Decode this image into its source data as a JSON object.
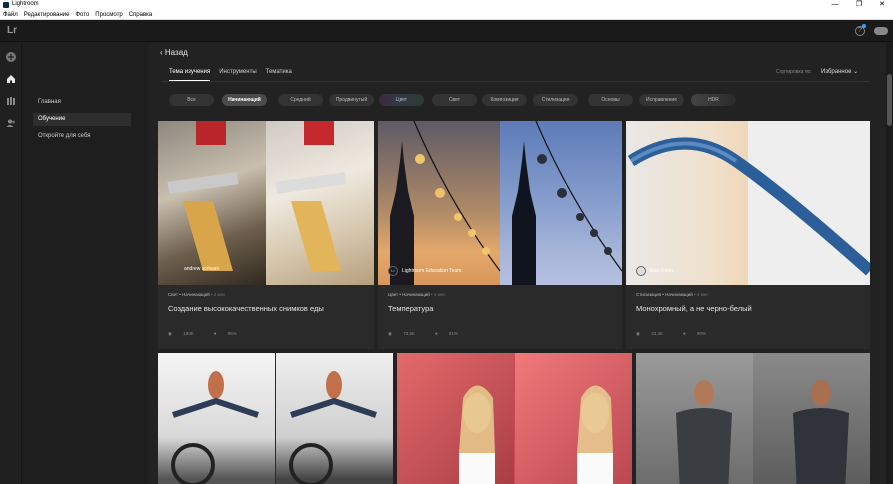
{
  "window": {
    "title": "Lightroom",
    "minimize": "—",
    "maximize": "❐",
    "close": "✕"
  },
  "menu": [
    "Файл",
    "Редактирование",
    "Фото",
    "Просмотр",
    "Справка"
  ],
  "app": {
    "logo": "Lr",
    "help": "?"
  },
  "rail_icons": [
    "add-icon",
    "home-icon",
    "library-icon",
    "people-icon"
  ],
  "leftnav": {
    "items": [
      {
        "label": "Главная"
      },
      {
        "label": "Обучение"
      },
      {
        "label": "Откройте для себя"
      }
    ]
  },
  "main": {
    "back_label": "Назад",
    "tabs": [
      {
        "label": "Тема изучения"
      },
      {
        "label": "Инструменты"
      },
      {
        "label": "Тематика"
      }
    ],
    "sort_label": "Сортировка по:",
    "sort_value": "Избранное ⌄",
    "chips": [
      {
        "label": "Все"
      },
      {
        "label": "Начинающий"
      },
      {
        "label": "Средний"
      },
      {
        "label": "Продвинутый"
      },
      {
        "label": "Цвет"
      },
      {
        "label": "Свет"
      },
      {
        "label": "Композиция"
      },
      {
        "label": "Стилизация"
      },
      {
        "label": "Основы"
      },
      {
        "label": "Исправление"
      },
      {
        "label": "HDR"
      }
    ],
    "cards": [
      {
        "author": "andrew scrivani",
        "avatar": "",
        "tag": "Свет • Начинающий",
        "ago": "• 4 мес",
        "title": "Создание высококачественных снимков еды",
        "views": "190K",
        "rating": "95%"
      },
      {
        "author": "Lightroom Education Team",
        "avatar": "Lr",
        "tag": "Цвет • Начинающий",
        "ago": "• 1 мес",
        "title": "Температура",
        "views": "73.6K",
        "rating": "91%"
      },
      {
        "author": "Nick Rains",
        "avatar": "",
        "tag": "Стилизация • Начинающий",
        "ago": "• 4 мес",
        "title": "Монохромный, а не черно-белый",
        "views": "23.3K",
        "rating": "90%"
      }
    ]
  },
  "colors": {
    "accent": "#3aa0ff",
    "panel": "#222222",
    "card": "#2a2a2a"
  }
}
